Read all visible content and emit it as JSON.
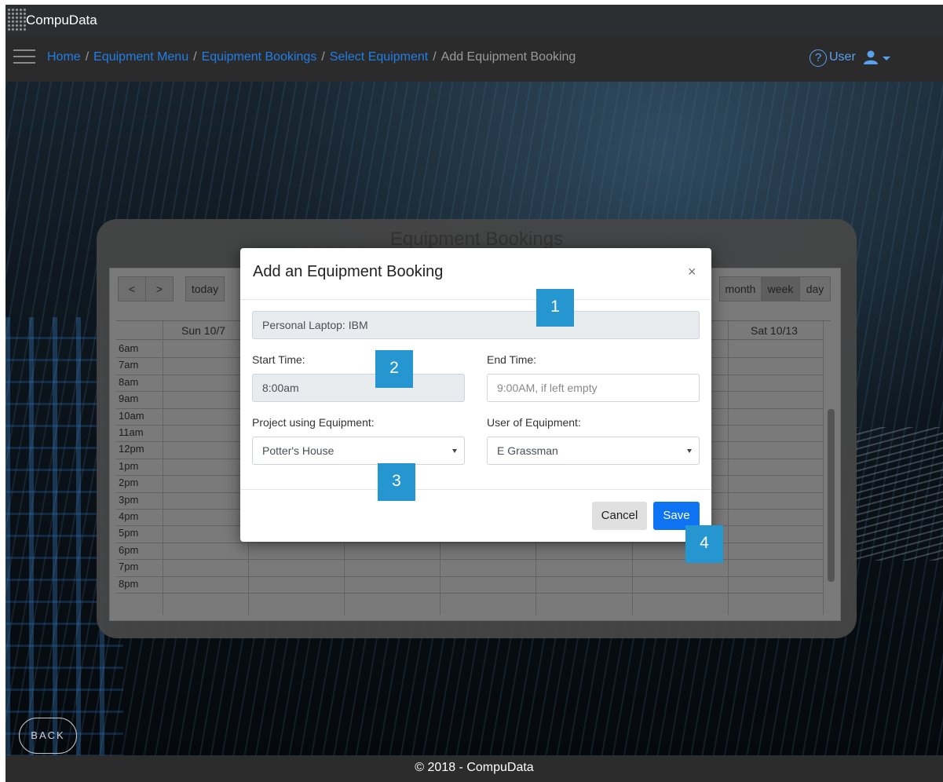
{
  "app": {
    "name": "CompuData"
  },
  "breadcrumb": {
    "items": [
      "Home",
      "Equipment Menu",
      "Equipment Bookings",
      "Select Equipment"
    ],
    "current": "Add Equipment Booking",
    "separator": "/"
  },
  "user_menu": {
    "help_icon": "?",
    "label": "User"
  },
  "calendar": {
    "title": "Equipment Bookings",
    "prev": "<",
    "next": ">",
    "today": "today",
    "views": [
      "month",
      "week",
      "day"
    ],
    "active_view": "week",
    "columns": [
      "Sun 10/7",
      "Sat 10/13"
    ],
    "times": [
      "6am",
      "7am",
      "8am",
      "9am",
      "10am",
      "11am",
      "12pm",
      "1pm",
      "2pm",
      "3pm",
      "4pm",
      "5pm",
      "6pm",
      "7pm",
      "8pm"
    ]
  },
  "modal": {
    "title": "Add an Equipment Booking",
    "close": "×",
    "equipment": "Personal Laptop: IBM",
    "start_label": "Start Time:",
    "start_value": "8:00am",
    "end_label": "End Time:",
    "end_placeholder": "9:00AM, if left empty",
    "project_label": "Project using Equipment:",
    "project_value": "Potter's House",
    "user_label": "User of Equipment:",
    "user_value": "E Grassman",
    "cancel": "Cancel",
    "save": "Save"
  },
  "callouts": [
    "1",
    "2",
    "3",
    "4"
  ],
  "back": "BACK",
  "footer": "© 2018 - CompuData",
  "colors": {
    "link": "#1f7ee8",
    "primary": "#0d73f2",
    "callout": "#2596cf",
    "navbar": "#2b2b2b"
  }
}
